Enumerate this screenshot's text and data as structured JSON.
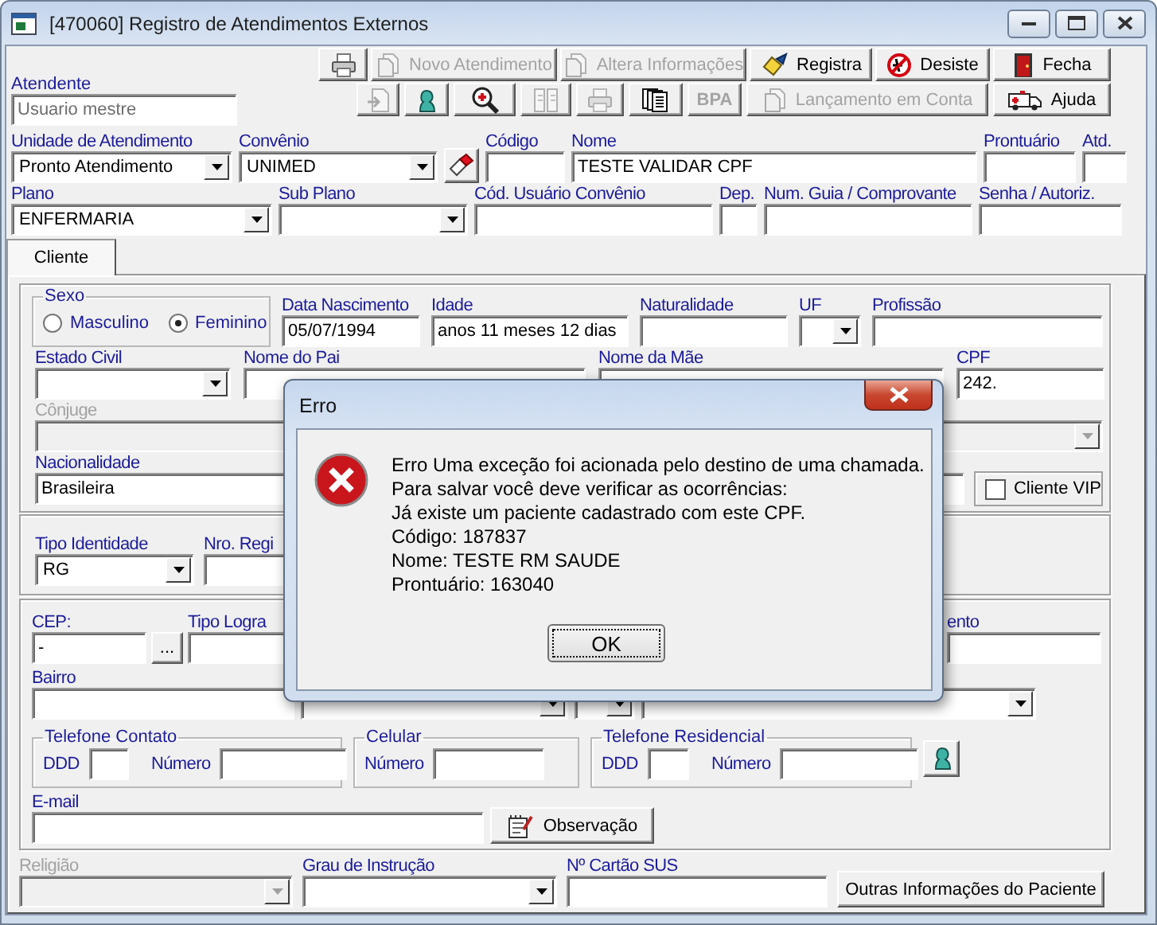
{
  "window": {
    "title": "[470060] Registro de Atendimentos Externos"
  },
  "toolbar": {
    "rows": [
      [
        {
          "disabled": false
        },
        {
          "label": "Novo Atendimento",
          "disabled": true
        },
        {
          "label": "Altera Informações",
          "disabled": true
        },
        {
          "label": "Registra",
          "disabled": false
        },
        {
          "label": "Desiste",
          "disabled": false
        },
        {
          "label": "Fecha",
          "disabled": false
        }
      ],
      [
        {
          "disabled": true
        },
        {
          "disabled": false
        },
        {
          "disabled": false
        },
        {
          "disabled": true
        },
        {
          "disabled": true
        },
        {
          "disabled": false
        },
        {
          "label": "BPA",
          "disabled": true
        },
        {
          "label": "Lançamento em Conta",
          "disabled": true
        },
        {
          "label": "Ajuda",
          "disabled": false
        }
      ]
    ]
  },
  "attendant": {
    "label": "Atendente",
    "value": "Usuario mestre"
  },
  "header": {
    "lines": [
      {
        "fields": [
          {
            "kind": "combo",
            "label": "Unidade de Atendimento",
            "value": "Pronto Atendimento",
            "disabled": false
          },
          {
            "kind": "combo",
            "label": "Convênio",
            "value": "UNIMED",
            "disabled": false
          },
          {
            "kind": "button",
            "disabled": false
          },
          {
            "kind": "text",
            "label": "Código",
            "disabled": false
          },
          {
            "kind": "text",
            "label": "Nome",
            "value": "TESTE VALIDAR CPF",
            "disabled": false
          },
          {
            "kind": "text",
            "label": "Prontuário",
            "disabled": false
          },
          {
            "kind": "text",
            "label": "Atd.",
            "disabled": false
          }
        ]
      },
      {
        "fields": [
          {
            "kind": "combo",
            "label": "Plano",
            "value": "ENFERMARIA",
            "disabled": false
          },
          {
            "kind": "combo",
            "label": "Sub Plano",
            "disabled": false
          },
          {
            "kind": "text",
            "label": "Cód. Usuário Convênio",
            "disabled": false
          },
          {
            "kind": "text",
            "label": "Dep.",
            "disabled": false
          },
          {
            "kind": "text",
            "label": "Num. Guia / Comprovante",
            "disabled": false
          },
          {
            "kind": "text",
            "label": "Senha / Autoriz.",
            "disabled": false
          }
        ]
      }
    ]
  },
  "tabs": [
    {
      "label": "Cliente",
      "selected": true
    }
  ],
  "patient": {
    "panels": [
      {
        "lines": [
          {
            "fields": [
              {
                "kind": "radio_group",
                "label": "Sexo",
                "disabled": false,
                "options": [
                  {
                    "label": "Masculino",
                    "selected": false
                  },
                  {
                    "label": "Feminino",
                    "selected": true
                  }
                ]
              },
              {
                "kind": "text",
                "label": "Data Nascimento",
                "value": "05/07/1994",
                "disabled": false
              },
              {
                "kind": "text",
                "label": "Idade",
                "value": "anos 11 meses 12 dias",
                "disabled": false
              },
              {
                "kind": "text",
                "label": "Naturalidade",
                "disabled": false
              },
              {
                "kind": "combo",
                "label": "UF",
                "disabled": false
              },
              {
                "kind": "text",
                "label": "Profissão",
                "disabled": false
              }
            ]
          },
          {
            "fields": [
              {
                "kind": "combo",
                "label": "Estado Civil",
                "disabled": false
              },
              {
                "kind": "text",
                "label": "Nome do Pai",
                "disabled": false
              },
              {
                "kind": "text",
                "label": "Nome da Mãe",
                "disabled": false
              },
              {
                "kind": "text",
                "label": "CPF",
                "value": "242.",
                "disabled": false
              }
            ]
          },
          {
            "fields": [
              {
                "kind": "combo",
                "label": "Cônjuge",
                "disabled": true
              }
            ]
          },
          {
            "fields": [
              {
                "kind": "text",
                "label": "Nacionalidade",
                "value": "Brasileira",
                "disabled": false
              },
              {
                "kind": "checkbox",
                "label": "Cliente VIP",
                "checked": false,
                "disabled": false
              }
            ]
          }
        ]
      },
      {
        "lines": [
          {
            "fields": [
              {
                "kind": "combo",
                "label": "Tipo Identidade",
                "value": "RG",
                "disabled": false
              },
              {
                "kind": "text",
                "label": "Nro. Regi",
                "disabled": false
              }
            ]
          }
        ]
      },
      {
        "lines": [
          {
            "fields": [
              {
                "kind": "text",
                "label": "CEP:",
                "value": "-",
                "disabled": false
              },
              {
                "kind": "button",
                "label": "...",
                "disabled": false
              },
              {
                "kind": "text",
                "label": "Tipo Logra",
                "disabled": false
              },
              {
                "kind": "text",
                "label": "ento",
                "disabled": false
              }
            ]
          },
          {
            "fields": [
              {
                "kind": "text",
                "label": "Bairro",
                "disabled": false
              },
              {
                "kind": "combo",
                "disabled": false
              },
              {
                "kind": "combo",
                "disabled": false
              },
              {
                "kind": "combo",
                "disabled": false
              }
            ]
          },
          {
            "fields": [
              {
                "kind": "group",
                "label": "Telefone Contato",
                "disabled": false,
                "fields": [
                  {
                    "kind": "text",
                    "label": "DDD",
                    "disabled": false
                  },
                  {
                    "kind": "text",
                    "label": "Número",
                    "disabled": false
                  }
                ]
              },
              {
                "kind": "group",
                "label": "Celular",
                "disabled": false,
                "fields": [
                  {
                    "kind": "text",
                    "label": "Número",
                    "disabled": false
                  }
                ]
              },
              {
                "kind": "group",
                "label": "Telefone Residencial",
                "disabled": false,
                "fields": [
                  {
                    "kind": "text",
                    "label": "DDD",
                    "disabled": false
                  },
                  {
                    "kind": "text",
                    "label": "Número",
                    "disabled": false
                  }
                ]
              },
              {
                "kind": "button",
                "disabled": false
              }
            ]
          },
          {
            "fields": [
              {
                "kind": "text",
                "label": "E-mail",
                "disabled": false
              },
              {
                "kind": "button",
                "label": "Observação",
                "disabled": false
              }
            ]
          }
        ]
      }
    ],
    "footer": {
      "fields": [
        {
          "kind": "combo",
          "label": "Religião",
          "disabled": true
        },
        {
          "kind": "combo",
          "label": "Grau de Instrução",
          "disabled": false
        },
        {
          "kind": "text",
          "label": "Nº Cartão SUS",
          "disabled": false
        },
        {
          "kind": "button",
          "label": "Outras Informações do Paciente",
          "disabled": false
        }
      ]
    }
  },
  "error_dialog": {
    "title": "Erro",
    "message": [
      "Erro Uma exceção foi acionada pelo destino de uma chamada.",
      "Para salvar você deve verificar as ocorrências:",
      "Já existe um paciente cadastrado com este CPF.",
      "Código: 187837",
      "Nome: TESTE RM SAUDE",
      "Prontuário: 163040"
    ],
    "button": "OK"
  }
}
